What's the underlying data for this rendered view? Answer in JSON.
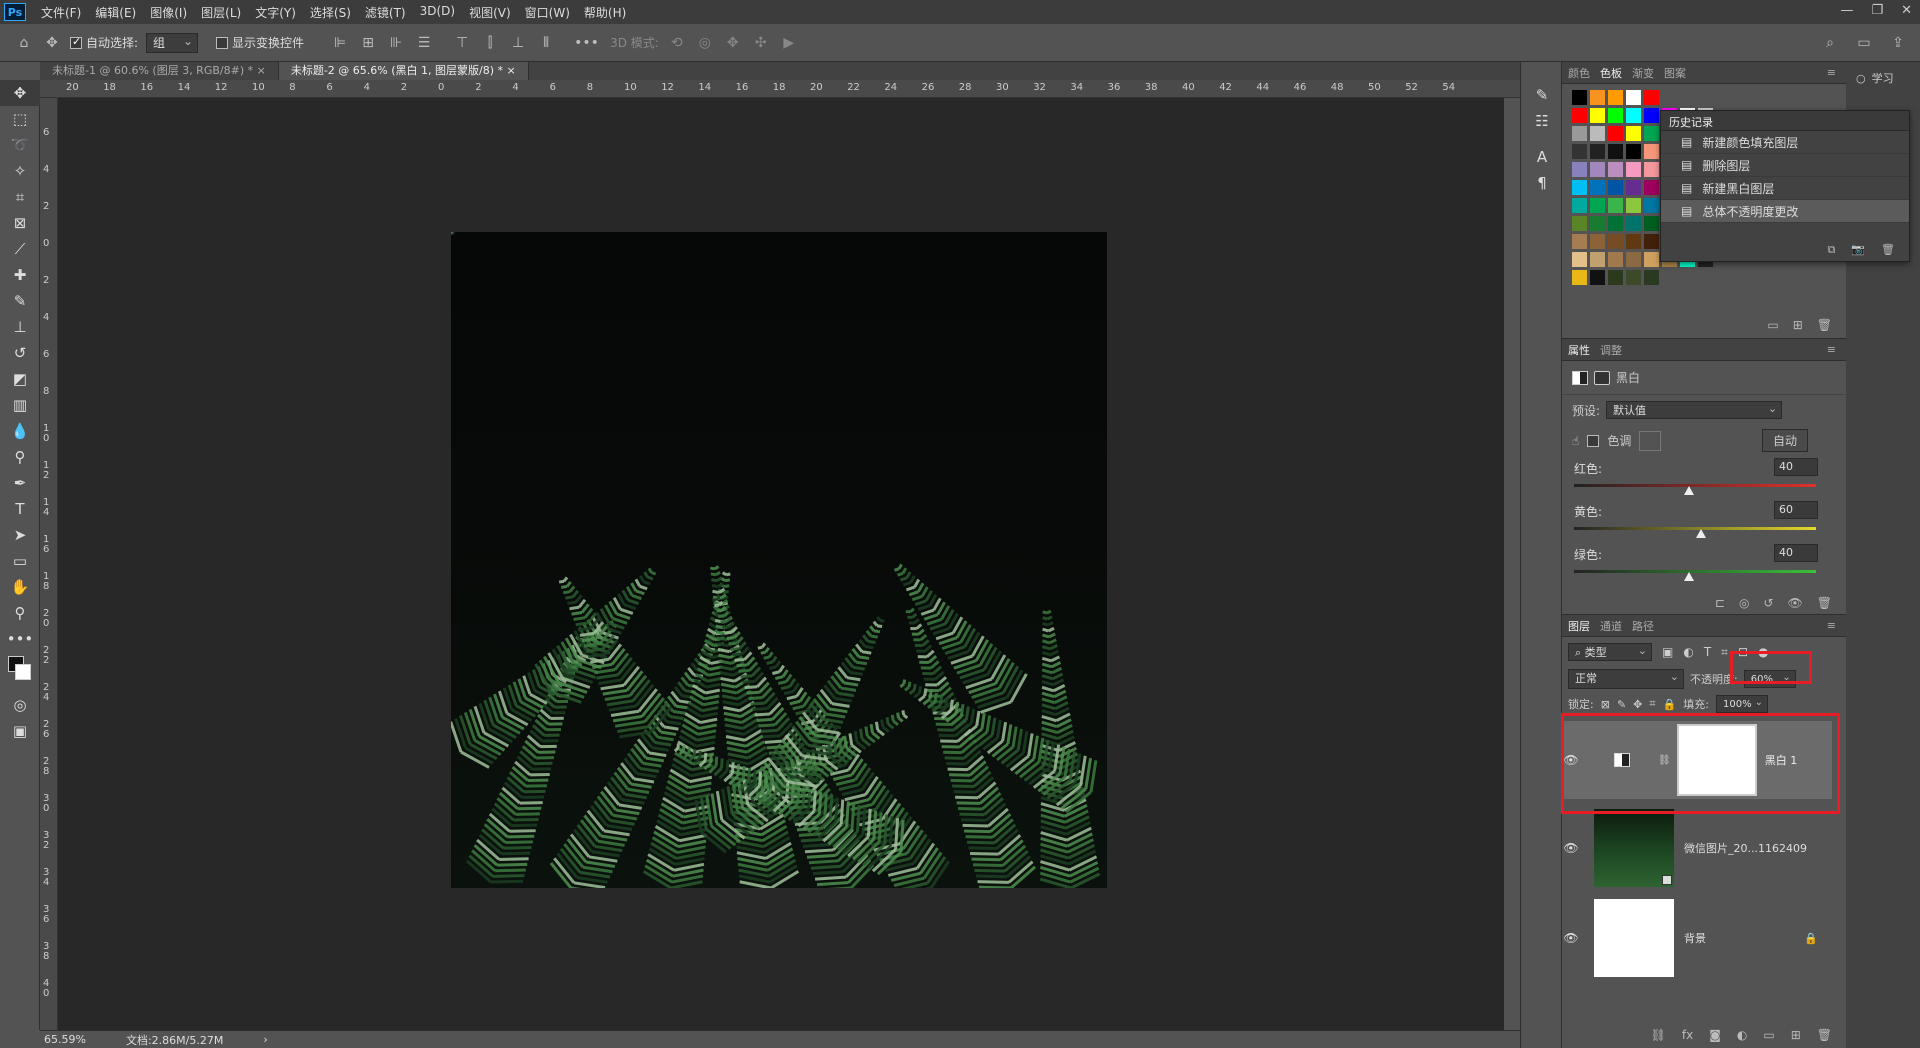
{
  "app": {
    "logo": "Ps"
  },
  "menu": [
    "文件(F)",
    "编辑(E)",
    "图像(I)",
    "图层(L)",
    "文字(Y)",
    "选择(S)",
    "滤镜(T)",
    "3D(D)",
    "视图(V)",
    "窗口(W)",
    "帮助(H)"
  ],
  "window_controls": [
    "—",
    "❐",
    "✕"
  ],
  "options": {
    "auto_select_label": "自动选择:",
    "auto_select_value": "组",
    "show_transform_label": "显示变换控件",
    "mode3d_label": "3D 模式:"
  },
  "tabs": [
    {
      "label": "未标题-1 @ 60.6% (图层 3, RGB/8#) *",
      "close": "×"
    },
    {
      "label": "未标题-2 @ 65.6% (黑白 1, 图层蒙版/8) *",
      "close": "×"
    }
  ],
  "ruler_top_labels": [
    "20",
    "18",
    "16",
    "14",
    "12",
    "10",
    "8",
    "6",
    "4",
    "2",
    "0",
    "2",
    "4",
    "6",
    "8",
    "10",
    "12",
    "14",
    "16",
    "18",
    "20",
    "22",
    "24",
    "26",
    "28",
    "30",
    "32",
    "34",
    "36",
    "38",
    "40",
    "42",
    "44",
    "46",
    "48",
    "50",
    "52",
    "54"
  ],
  "ruler_left_labels": [
    "6",
    "4",
    "2",
    "0",
    "2",
    "4",
    "6",
    "8",
    "1\n0",
    "1\n2",
    "1\n4",
    "1\n6",
    "1\n8",
    "2\n0",
    "2\n2",
    "2\n4",
    "2\n6",
    "2\n8",
    "3\n0",
    "3\n2",
    "3\n4",
    "3\n6",
    "3\n8",
    "4\n0"
  ],
  "status": {
    "zoom": "65.59%",
    "doc": "文档:2.86M/5.27M",
    "arrow": "›"
  },
  "swatches_panel": {
    "tabs": [
      "颜色",
      "色板",
      "渐变",
      "图案"
    ],
    "active": "色板"
  },
  "learn_label": "学习",
  "history": {
    "title": "历史记录",
    "items": [
      "新建颜色填充图层",
      "删除图层",
      "新建黑白图层",
      "总体不透明度更改"
    ]
  },
  "properties": {
    "tabs": [
      "属性",
      "调整"
    ],
    "type_label": "黑白",
    "preset_label": "预设:",
    "preset_value": "默认值",
    "tint_label": "色调",
    "auto_button": "自动",
    "sliders": [
      {
        "label": "红色:",
        "value": "40",
        "pos": 0.5,
        "gradient": "linear-gradient(90deg,#222,#e0302a)"
      },
      {
        "label": "黄色:",
        "value": "60",
        "pos": 0.55,
        "gradient": "linear-gradient(90deg,#222,#e5d92c)"
      },
      {
        "label": "绿色:",
        "value": "40",
        "pos": 0.5,
        "gradient": "linear-gradient(90deg,#222,#3ac13a)"
      }
    ]
  },
  "layers": {
    "tabs": [
      "图层",
      "通道",
      "路径"
    ],
    "filter_value": "类型",
    "blend_mode": "正常",
    "opacity_label": "不透明度:",
    "opacity_value": "60%",
    "lock_label": "锁定:",
    "fill_label": "填充:",
    "fill_value": "100%",
    "items": [
      {
        "name": "黑白 1"
      },
      {
        "name": "微信图片_20...1162409"
      },
      {
        "name": "背景"
      }
    ]
  },
  "colors": {
    "highlight": "#e81c24"
  }
}
